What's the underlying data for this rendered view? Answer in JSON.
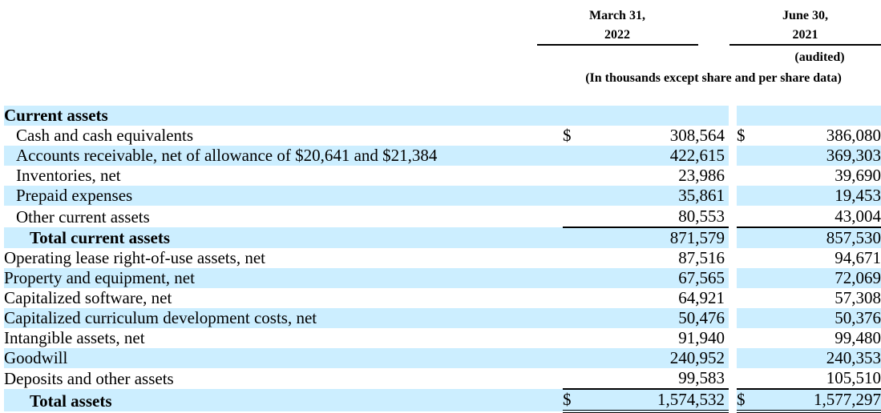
{
  "header": {
    "col1_line1": "March 31,",
    "col1_line2": "2022",
    "col2_line1": "June 30,",
    "col2_line2": "2021",
    "col2_note": "(audited)",
    "units_note": "(In thousands except share and per share data)"
  },
  "rows": [
    {
      "label": "Current assets",
      "cur1": "",
      "val1": "",
      "cur2": "",
      "val2": ""
    },
    {
      "label": "Cash and cash equivalents",
      "cur1": "$",
      "val1": "308,564",
      "cur2": "$",
      "val2": "386,080"
    },
    {
      "label": "Accounts receivable, net of allowance of $20,641 and $21,384",
      "cur1": "",
      "val1": "422,615",
      "cur2": "",
      "val2": "369,303"
    },
    {
      "label": "Inventories, net",
      "cur1": "",
      "val1": "23,986",
      "cur2": "",
      "val2": "39,690"
    },
    {
      "label": "Prepaid expenses",
      "cur1": "",
      "val1": "35,861",
      "cur2": "",
      "val2": "19,453"
    },
    {
      "label": "Other current assets",
      "cur1": "",
      "val1": "80,553",
      "cur2": "",
      "val2": "43,004"
    },
    {
      "label": "Total current assets",
      "cur1": "",
      "val1": "871,579",
      "cur2": "",
      "val2": "857,530"
    },
    {
      "label": "Operating lease right-of-use assets, net",
      "cur1": "",
      "val1": "87,516",
      "cur2": "",
      "val2": "94,671"
    },
    {
      "label": "Property and equipment, net",
      "cur1": "",
      "val1": "67,565",
      "cur2": "",
      "val2": "72,069"
    },
    {
      "label": "Capitalized software, net",
      "cur1": "",
      "val1": "64,921",
      "cur2": "",
      "val2": "57,308"
    },
    {
      "label": "Capitalized curriculum development costs, net",
      "cur1": "",
      "val1": "50,476",
      "cur2": "",
      "val2": "50,376"
    },
    {
      "label": "Intangible assets, net",
      "cur1": "",
      "val1": "91,940",
      "cur2": "",
      "val2": "99,480"
    },
    {
      "label": "Goodwill",
      "cur1": "",
      "val1": "240,952",
      "cur2": "",
      "val2": "240,353"
    },
    {
      "label": "Deposits and other assets",
      "cur1": "",
      "val1": "99,583",
      "cur2": "",
      "val2": "105,510"
    },
    {
      "label": "Total assets",
      "cur1": "$",
      "val1": "1,574,532",
      "cur2": "$",
      "val2": "1,577,297"
    }
  ]
}
